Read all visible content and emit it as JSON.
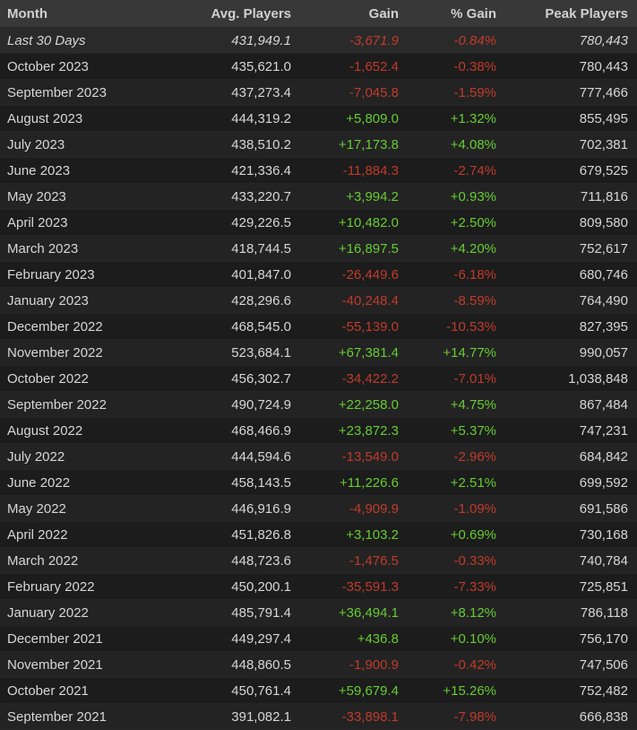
{
  "table": {
    "headers": [
      "Month",
      "Avg. Players",
      "Gain",
      "% Gain",
      "Peak Players"
    ],
    "rows": [
      {
        "month": "Last 30 Days",
        "avg": "431,949.1",
        "gain": "-3,671.9",
        "pct": "-0.84%",
        "peak": "780,443",
        "trend": "neg"
      },
      {
        "month": "October 2023",
        "avg": "435,621.0",
        "gain": "-1,652.4",
        "pct": "-0.38%",
        "peak": "780,443",
        "trend": "neg"
      },
      {
        "month": "September 2023",
        "avg": "437,273.4",
        "gain": "-7,045.8",
        "pct": "-1.59%",
        "peak": "777,466",
        "trend": "neg"
      },
      {
        "month": "August 2023",
        "avg": "444,319.2",
        "gain": "+5,809.0",
        "pct": "+1.32%",
        "peak": "855,495",
        "trend": "pos"
      },
      {
        "month": "July 2023",
        "avg": "438,510.2",
        "gain": "+17,173.8",
        "pct": "+4.08%",
        "peak": "702,381",
        "trend": "pos"
      },
      {
        "month": "June 2023",
        "avg": "421,336.4",
        "gain": "-11,884.3",
        "pct": "-2.74%",
        "peak": "679,525",
        "trend": "neg"
      },
      {
        "month": "May 2023",
        "avg": "433,220.7",
        "gain": "+3,994.2",
        "pct": "+0.93%",
        "peak": "711,816",
        "trend": "pos"
      },
      {
        "month": "April 2023",
        "avg": "429,226.5",
        "gain": "+10,482.0",
        "pct": "+2.50%",
        "peak": "809,580",
        "trend": "pos"
      },
      {
        "month": "March 2023",
        "avg": "418,744.5",
        "gain": "+16,897.5",
        "pct": "+4.20%",
        "peak": "752,617",
        "trend": "pos"
      },
      {
        "month": "February 2023",
        "avg": "401,847.0",
        "gain": "-26,449.6",
        "pct": "-6.18%",
        "peak": "680,746",
        "trend": "neg"
      },
      {
        "month": "January 2023",
        "avg": "428,296.6",
        "gain": "-40,248.4",
        "pct": "-8.59%",
        "peak": "764,490",
        "trend": "neg"
      },
      {
        "month": "December 2022",
        "avg": "468,545.0",
        "gain": "-55,139.0",
        "pct": "-10.53%",
        "peak": "827,395",
        "trend": "neg"
      },
      {
        "month": "November 2022",
        "avg": "523,684.1",
        "gain": "+67,381.4",
        "pct": "+14.77%",
        "peak": "990,057",
        "trend": "pos"
      },
      {
        "month": "October 2022",
        "avg": "456,302.7",
        "gain": "-34,422.2",
        "pct": "-7.01%",
        "peak": "1,038,848",
        "trend": "neg"
      },
      {
        "month": "September 2022",
        "avg": "490,724.9",
        "gain": "+22,258.0",
        "pct": "+4.75%",
        "peak": "867,484",
        "trend": "pos"
      },
      {
        "month": "August 2022",
        "avg": "468,466.9",
        "gain": "+23,872.3",
        "pct": "+5.37%",
        "peak": "747,231",
        "trend": "pos"
      },
      {
        "month": "July 2022",
        "avg": "444,594.6",
        "gain": "-13,549.0",
        "pct": "-2.96%",
        "peak": "684,842",
        "trend": "neg"
      },
      {
        "month": "June 2022",
        "avg": "458,143.5",
        "gain": "+11,226.6",
        "pct": "+2.51%",
        "peak": "699,592",
        "trend": "pos"
      },
      {
        "month": "May 2022",
        "avg": "446,916.9",
        "gain": "-4,909.9",
        "pct": "-1.09%",
        "peak": "691,586",
        "trend": "neg"
      },
      {
        "month": "April 2022",
        "avg": "451,826.8",
        "gain": "+3,103.2",
        "pct": "+0.69%",
        "peak": "730,168",
        "trend": "pos"
      },
      {
        "month": "March 2022",
        "avg": "448,723.6",
        "gain": "-1,476.5",
        "pct": "-0.33%",
        "peak": "740,784",
        "trend": "neg"
      },
      {
        "month": "February 2022",
        "avg": "450,200.1",
        "gain": "-35,591.3",
        "pct": "-7.33%",
        "peak": "725,851",
        "trend": "neg"
      },
      {
        "month": "January 2022",
        "avg": "485,791.4",
        "gain": "+36,494.1",
        "pct": "+8.12%",
        "peak": "786,118",
        "trend": "pos"
      },
      {
        "month": "December 2021",
        "avg": "449,297.4",
        "gain": "+436.8",
        "pct": "+0.10%",
        "peak": "756,170",
        "trend": "pos"
      },
      {
        "month": "November 2021",
        "avg": "448,860.5",
        "gain": "-1,900.9",
        "pct": "-0.42%",
        "peak": "747,506",
        "trend": "neg"
      },
      {
        "month": "October 2021",
        "avg": "450,761.4",
        "gain": "+59,679.4",
        "pct": "+15.26%",
        "peak": "752,482",
        "trend": "pos"
      },
      {
        "month": "September 2021",
        "avg": "391,082.1",
        "gain": "-33,898.1",
        "pct": "-7.98%",
        "peak": "666,838",
        "trend": "neg"
      }
    ]
  },
  "colors": {
    "positive": "#66cc33",
    "negative": "#c03b2b",
    "background": "#1b1b1b",
    "header_background": "#383838"
  }
}
